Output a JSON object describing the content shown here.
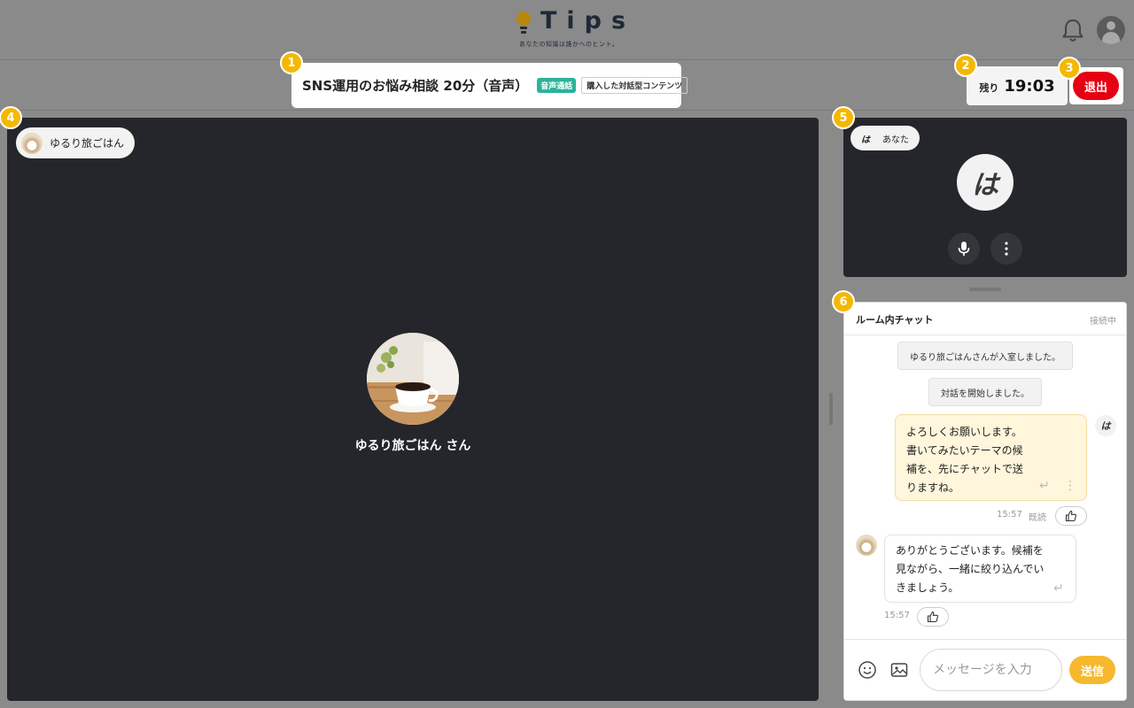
{
  "header": {
    "logo_text": "Tips",
    "logo_tagline": "あなたの知識は誰かへのヒント。"
  },
  "session": {
    "title": "SNS運用のお悩み相談 20分（音声）",
    "tag_primary": "音声通話",
    "tag_secondary": "購入した対話型コンテンツ"
  },
  "timer": {
    "label": "残り",
    "value": "19:03"
  },
  "exit_label": "退出",
  "badges": [
    "1",
    "2",
    "3",
    "4",
    "5",
    "6"
  ],
  "remote": {
    "name": "ゆるり旅ごはん",
    "display_name": "ゆるり旅ごはん さん"
  },
  "self": {
    "initial": "は",
    "name": "あなた"
  },
  "chat": {
    "title": "ルーム内チャット",
    "status": "接続中",
    "system_messages": [
      "ゆるり旅ごはんさんが入室しました。",
      "対話を開始しました。"
    ],
    "my_message": {
      "lines": [
        "よろしくお願いします。",
        "書いてみたいテーマの候",
        "補を、先にチャットで送",
        "りますね。"
      ],
      "time": "15:57",
      "read": "既読",
      "avatar": "は"
    },
    "their_message": {
      "lines": [
        "ありがとうございます。候補を",
        "見ながら、一緒に絞り込んでい",
        "きましょう。"
      ],
      "time": "15:57"
    },
    "input_placeholder": "メッセージを入力",
    "send_label": "送信"
  },
  "colors": {
    "accent": "#f5b800",
    "exit": "#e60012",
    "send": "#f5b82e",
    "tag_green": "#2bb39a",
    "video_bg": "#24262b"
  }
}
